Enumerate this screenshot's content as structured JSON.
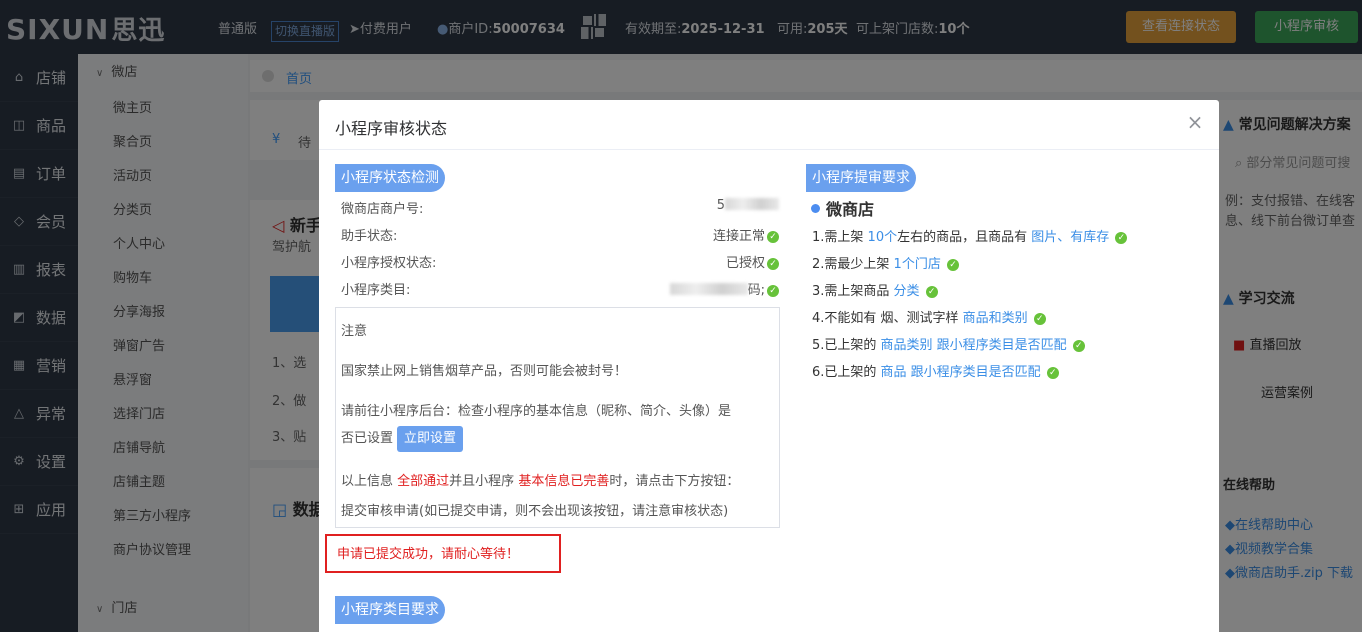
{
  "topbar": {
    "logo_text": "SIXUN",
    "logo_cn": "思迅",
    "edition": "普通版",
    "switch_live": "切换直播版",
    "paid_user": "付费用户",
    "merchant_id_label": "商户ID:",
    "merchant_id": "50007634",
    "valid_until_label": "有效期至:",
    "valid_until": "2025-12-31",
    "available_label": "可用:",
    "available_days": "205天",
    "stores_label": "可上架门店数:",
    "stores_count": "10个",
    "check_connection": "查看连接状态",
    "miniprogram_review": "小程序审核"
  },
  "left_nav": [
    {
      "label": "店铺",
      "icon": "store-icon"
    },
    {
      "label": "商品",
      "icon": "gift-icon"
    },
    {
      "label": "订单",
      "icon": "order-icon"
    },
    {
      "label": "会员",
      "icon": "diamond-icon"
    },
    {
      "label": "报表",
      "icon": "bar-chart-icon"
    },
    {
      "label": "数据",
      "icon": "trend-chart-icon"
    },
    {
      "label": "营销",
      "icon": "column-chart-icon"
    },
    {
      "label": "异常",
      "icon": "warning-icon"
    },
    {
      "label": "设置",
      "icon": "gear-icon"
    },
    {
      "label": "应用",
      "icon": "apps-icon"
    }
  ],
  "sub_nav": {
    "group1": "微店",
    "items": [
      "微主页",
      "聚合页",
      "活动页",
      "分类页",
      "个人中心",
      "购物车",
      "分享海报",
      "弹窗广告",
      "悬浮窗",
      "选择门店",
      "店铺导航",
      "店铺主题",
      "第三方小程序",
      "商户协议管理"
    ],
    "group2": "门店"
  },
  "background": {
    "breadcrumb_home": "首页",
    "pending": "待",
    "newbie": "新手",
    "navigate": "驾护航",
    "step1": "1、选",
    "step2": "2、做",
    "step3": "3、贴",
    "data_title": "数据",
    "faq_title": "常见问题解决方案",
    "faq_search_placeholder": "部分常见问题可搜",
    "faq_example_1": "例：支付报错、在线客",
    "faq_example_2": "息、线下前台微订单查",
    "learn_title": "学习交流",
    "live_replay": "直播回放",
    "ops_cases": "运营案例",
    "online_help": "在线帮助",
    "help_links": [
      "◆在线帮助中心",
      "◆视频教学合集",
      "◆微商店助手.zip 下载"
    ]
  },
  "modal": {
    "title": "小程序审核状态",
    "status_check_title": "小程序状态检测",
    "rows": [
      {
        "label": "微商店商户号:",
        "value": "5"
      },
      {
        "label": "助手状态:",
        "value": "连接正常"
      },
      {
        "label": "小程序授权状态:",
        "value": "已授权"
      },
      {
        "label": "小程序类目:",
        "value": "码;"
      }
    ],
    "notice_title": "注意",
    "notice_ban": "国家禁止网上销售烟草产品，否则可能会被封号！",
    "notice_check_1": "请前往小程序后台：检查小程序的基本信息（昵称、简介、头像）是",
    "notice_check_2": "否已设置",
    "set_now": "立即设置",
    "notice_submit_pre": "以上信息",
    "notice_submit_red1": "全部通过",
    "notice_submit_mid": "并且小程序",
    "notice_submit_red2": "基本信息已完善",
    "notice_submit_post": "时，请点击下方按钮：",
    "notice_submit_2": "提交审核申请(如已提交申请，则不会出现该按钮，请注意审核状态)",
    "success_msg": "申请已提交成功，请耐心等待！",
    "category_req_title": "小程序类目要求",
    "review_req_title": "小程序提审要求",
    "store_type": "微商店",
    "requirements": [
      {
        "pre": "1.需上架 ",
        "link1": "10个",
        "mid": "左右的商品，且商品有 ",
        "link2": "图片、有库存",
        "post": ""
      },
      {
        "pre": "2.需最少上架 ",
        "link1": "1个门店",
        "mid": "",
        "link2": "",
        "post": ""
      },
      {
        "pre": "3.需上架商品 ",
        "link1": "分类",
        "mid": "",
        "link2": "",
        "post": ""
      },
      {
        "pre": "4.不能如有 烟、测试字样 ",
        "link1": "商品和类别",
        "mid": "",
        "link2": "",
        "post": ""
      },
      {
        "pre": "5.已上架的 ",
        "link1": "商品类别 跟小程序类目是否匹配",
        "mid": "",
        "link2": "",
        "post": ""
      },
      {
        "pre": "6.已上架的 ",
        "link1": "商品 跟小程序类目是否匹配",
        "mid": "",
        "link2": "",
        "post": ""
      }
    ]
  }
}
